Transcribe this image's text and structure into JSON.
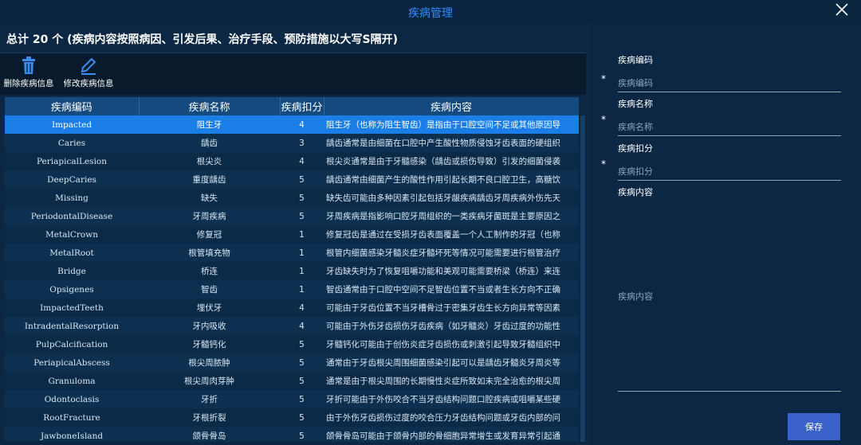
{
  "window": {
    "title": "疾病管理"
  },
  "summary": "总计 20 个 (疾病内容按照病因、引发后果、治疗手段、预防措施以大写S隔开)",
  "toolbar": {
    "delete_label": "删除疾病信息",
    "edit_label": "修改疾病信息"
  },
  "table": {
    "columns": [
      "疾病编码",
      "疾病名称",
      "疾病扣分",
      "疾病内容"
    ],
    "rows": [
      {
        "code": "Impacted",
        "name": "阻生牙",
        "score": "4",
        "content": "阻生牙（也称为阻生智齿）是指由于口腔空间不足或其他原因导"
      },
      {
        "code": "Caries",
        "name": "龋齿",
        "score": "3",
        "content": "龋齿通常是由细菌在口腔中产生酸性物质侵蚀牙齿表面的硬组织"
      },
      {
        "code": "PeriapicalLesion",
        "name": "根尖炎",
        "score": "4",
        "content": "根尖炎通常是由于牙髓感染（龋齿或损伤导致）引发的细菌侵袭"
      },
      {
        "code": "DeepCaries",
        "name": "重度龋齿",
        "score": "5",
        "content": "龋齿通常由细菌产生的酸性作用引起长期不良口腔卫生，高糖饮"
      },
      {
        "code": "Missing",
        "name": "缺失",
        "score": "5",
        "content": "缺失齿可能由多种因素引起包括牙龈疾病龋齿牙周疾病外伤先天"
      },
      {
        "code": "PeriodontalDisease",
        "name": "牙周疾病",
        "score": "5",
        "content": "牙周疾病是指影响口腔牙周组织的一类疾病牙菌斑是主要原因之"
      },
      {
        "code": "MetalCrown",
        "name": "修复冠",
        "score": "1",
        "content": "修复冠齿是通过在受损牙齿表面覆盖一个人工制作的牙冠（也称"
      },
      {
        "code": "MetalRoot",
        "name": "根管填充物",
        "score": "1",
        "content": "根管内细菌感染牙髓炎症牙髓坏死等情况可能需要进行根管治疗"
      },
      {
        "code": "Bridge",
        "name": "桥连",
        "score": "1",
        "content": "牙齿缺失时为了恢复咀嚼功能和美观可能需要桥梁（桥连）来连"
      },
      {
        "code": "Opsigenes",
        "name": "智齿",
        "score": "1",
        "content": "智齿通常由于口腔中空间不足智齿位置不当或者生长方向不正确"
      },
      {
        "code": "ImpactedTeeth",
        "name": "埋伏牙",
        "score": "4",
        "content": "可能由于牙齿位置不当牙槽骨过于密集牙齿生长方向异常等因素"
      },
      {
        "code": "IntradentalResorption",
        "name": "牙内吸收",
        "score": "4",
        "content": "可能由于外伤牙齿损伤牙齿疾病（如牙髓炎）牙齿过度的功能性"
      },
      {
        "code": "PulpCalcification",
        "name": "牙髓钙化",
        "score": "5",
        "content": "牙髓钙化可能由于创伤炎症牙齿损伤或刺激引起导致牙髓组织中"
      },
      {
        "code": "PeriapicalAbscess",
        "name": "根尖周脓肿",
        "score": "5",
        "content": "通常由于牙齿根尖周围细菌感染引起可以是龋齿牙髓炎牙周炎等"
      },
      {
        "code": "Granuloma",
        "name": "根尖周肉芽肿",
        "score": "5",
        "content": "通常是由于根尖周围的长期慢性炎症所致如未完全治愈的根尖周"
      },
      {
        "code": "Odontoclasis",
        "name": "牙折",
        "score": "5",
        "content": "牙折可能由于外伤咬合不当牙齿结构问题口腔疾病或咀嚼某些硬"
      },
      {
        "code": "RootFracture",
        "name": "牙根折裂",
        "score": "5",
        "content": "由于外伤牙齿损伤过度的咬合压力牙齿结构问题或牙齿内部的问"
      },
      {
        "code": "JawboneIsland",
        "name": "颌骨骨岛",
        "score": "5",
        "content": "颌骨骨岛可能由于颌骨内部的骨细胞异常增生或发育异常引起通"
      }
    ]
  },
  "form": {
    "code_label": "疾病编码",
    "code_placeholder": "疾病编码",
    "name_label": "疾病名称",
    "name_placeholder": "疾病名称",
    "score_label": "疾病扣分",
    "score_placeholder": "疾病扣分",
    "content_label": "疾病内容",
    "content_placeholder": "疾病内容",
    "required_mark": "*",
    "save_label": "保存"
  },
  "colors": {
    "background": "#0b2743",
    "selected_row": "#1a7ee6",
    "header": "#144a7e",
    "accent": "#2f8bff",
    "save_button": "#3a62c8"
  }
}
